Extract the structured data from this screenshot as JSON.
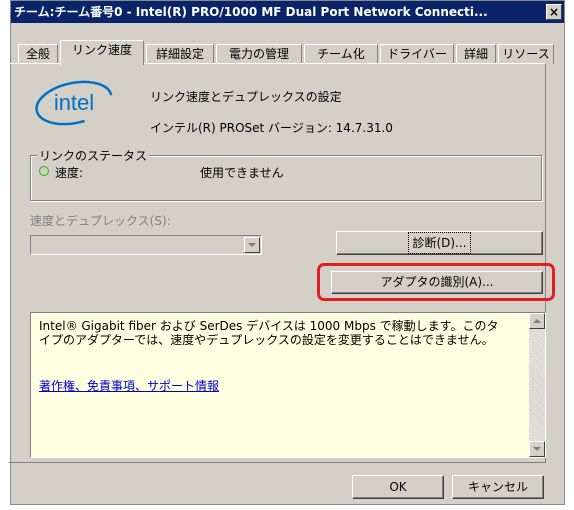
{
  "window": {
    "title": "チーム:チーム番号0 - Intel(R) PRO/1000 MF Dual Port Network Connecti...",
    "close_glyph": "×"
  },
  "tabs": [
    {
      "label": "全般",
      "active": false
    },
    {
      "label": "リンク速度",
      "active": true
    },
    {
      "label": "詳細設定",
      "active": false
    },
    {
      "label": "電力の管理",
      "active": false
    },
    {
      "label": "チーム化",
      "active": false
    },
    {
      "label": "ドライバー",
      "active": false
    },
    {
      "label": "詳細",
      "active": false
    },
    {
      "label": "リソース",
      "active": false
    }
  ],
  "header": {
    "logo_text": "intel",
    "title": "リンク速度とデュプレックスの設定",
    "version": "インテル(R) PROSet バージョン: 14.7.31.0"
  },
  "link_status": {
    "group_label": "リンクのステータス",
    "speed_label": "速度:",
    "speed_value": "使用できません"
  },
  "speed_duplex": {
    "label": "速度とデュプレックス(S):",
    "selected_value": ""
  },
  "buttons": {
    "diagnose": "診断(D)...",
    "identify_adapter": "アダプタの識別(A)...",
    "ok": "OK",
    "cancel": "キャンセル"
  },
  "info": {
    "text": "Intel® Gigabit fiber および SerDes デバイスは 1000 Mbps で稼動します。このタイプのアダプターでは、速度やデュプレックスの設定を変更することはできません。",
    "link": "著作権、免責事項、サポート情報"
  },
  "colors": {
    "titlebar": "#0a246a",
    "highlight": "#e02020",
    "info_bg": "#ffffe1",
    "intel_blue": "#0071c5"
  }
}
